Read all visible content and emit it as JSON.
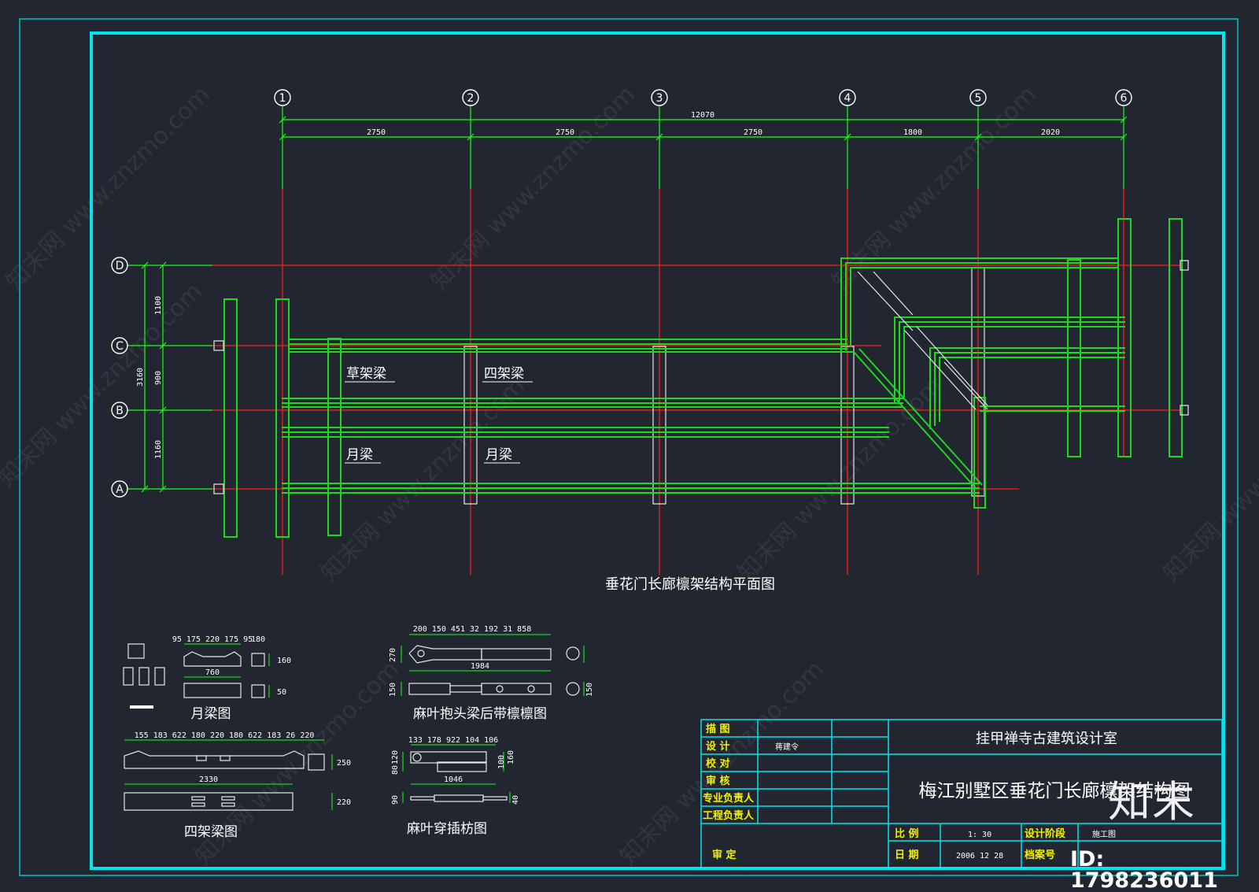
{
  "axes": {
    "columns": [
      "1",
      "2",
      "3",
      "4",
      "5",
      "6"
    ],
    "rows": [
      "D",
      "C",
      "B",
      "A"
    ],
    "overall_dim": "12070",
    "col_dims": [
      "2750",
      "2750",
      "2750",
      "1800",
      "2020"
    ],
    "row_dims": [
      "1100",
      "900",
      "1160"
    ],
    "row_total": "3160"
  },
  "plan": {
    "title": "垂花门长廊檩架结构平面图",
    "labels": {
      "grass_beam_1": "草架梁",
      "four_beam_1": "四架梁",
      "moon_beam_1": "月梁",
      "moon_beam_2": "月梁"
    }
  },
  "details": {
    "moon_beam": {
      "caption": "月梁图",
      "dims_top": "95 175 220 175 95",
      "dim_side": "180",
      "dim_len": "760",
      "dim_h1": "160",
      "dim_h2": "50"
    },
    "ridge_beam": {
      "caption": "麻叶抱头梁后带檩檩图",
      "dims_top": "200 150    451 32 192 31    858",
      "dim_len": "1984",
      "dim_left": "270",
      "dim_left2": "150",
      "dim_right": "150"
    },
    "four_beam": {
      "caption": "四架梁图",
      "dims_top": "155 183    622    180 220 180    622    183 26 220",
      "dim_len": "2330",
      "dim_h1": "250",
      "dim_h2": "220"
    },
    "tie_beam": {
      "caption": "麻叶穿插枋图",
      "dims_top": "133 178   922   104 106",
      "dim_len": "1046",
      "dim_left": "120",
      "dim_left2": "80",
      "dim_right": "160",
      "dim_right2": "100",
      "dim_r3": "40",
      "dim_l3": "90"
    }
  },
  "title_block": {
    "rows": [
      {
        "label": "描 图",
        "value": ""
      },
      {
        "label": "设 计",
        "value": "蒋建令"
      },
      {
        "label": "校 对",
        "value": ""
      },
      {
        "label": "审 核",
        "value": ""
      },
      {
        "label": "专业负责人",
        "value": ""
      },
      {
        "label": "工程负责人",
        "value": ""
      }
    ],
    "approve_label": "审 定",
    "company": "挂甲禅寺古建筑设计室",
    "drawing_title": "梅江别墅区垂花门长廊檩架结构图",
    "scale_label": "比 例",
    "scale_value": "1: 30",
    "date_label": "日 期",
    "date_value": "2006 12 28",
    "stage_label": "设计阶段",
    "stage_value": "施工图",
    "archive_label": "档案号",
    "archive_value": ""
  },
  "watermark": {
    "text": "知末网 www.znzmo.com",
    "logo": "知末",
    "id": "ID: 1798236011"
  },
  "colors": {
    "background": "#212630",
    "frame": "#00e5ee",
    "axis": "#ff1a1a",
    "dim": "#16ff16",
    "member": "#1ed81e",
    "label_yellow": "#f2f200"
  }
}
